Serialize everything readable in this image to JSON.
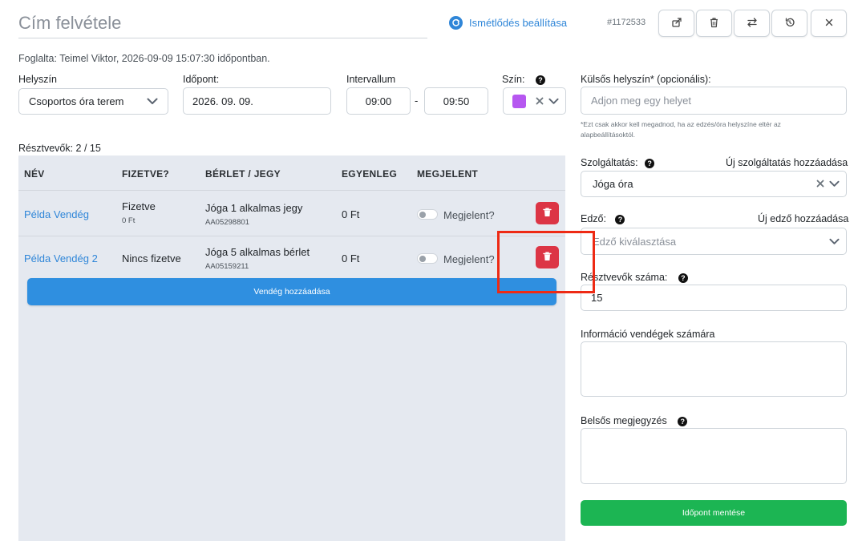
{
  "header": {
    "title_placeholder": "Cím felvétele",
    "recurrence_label": "Ismétlődés beállítása",
    "event_id": "#1172533"
  },
  "booked_by": "Foglalta: Teimel Viktor, 2026-09-09 15:07:30 időpontban.",
  "form": {
    "location_label": "Helyszín",
    "location_value": "Csoportos óra terem",
    "date_label": "Időpont:",
    "date_value": "2026. 09. 09.",
    "interval_label": "Intervallum",
    "interval_start": "09:00",
    "interval_sep": "-",
    "interval_end": "09:50",
    "color_label": "Szín:",
    "color_value": "#b657f0",
    "external_location_label": "Külsős helyszín* (opcionális):",
    "external_location_placeholder": "Adjon meg egy helyet",
    "external_hint": "*Ezt csak akkor kell megadnod, ha az edzés/óra helyszíne eltér az alapbeállításoktól.",
    "service_label": "Szolgáltatás:",
    "service_add_link": "Új szolgáltatás hozzáadása",
    "service_value": "Jóga óra",
    "trainer_label": "Edző:",
    "trainer_add_link": "Új edző hozzáadása",
    "trainer_placeholder": "Edző kiválasztása",
    "participants_count_label": "Résztvevők száma:",
    "participants_count_value": "15",
    "guest_info_label": "Információ vendégek számára",
    "internal_note_label": "Belsős megjegyzés",
    "save_label": "Időpont mentése"
  },
  "participants": {
    "count_label": "Résztvevők: 2 / 15",
    "columns": [
      "NÉV",
      "FIZETVE?",
      "BÉRLET / JEGY",
      "EGYENLEG",
      "MEGJELENT"
    ],
    "rows": [
      {
        "name": "Példa Vendég",
        "paid": "Fizetve",
        "paid_amount": "0 Ft",
        "pass": "Jóga 1 alkalmas jegy",
        "pass_code": "AA05298801",
        "balance": "0 Ft",
        "attended_label": "Megjelent?"
      },
      {
        "name": "Példa Vendég 2",
        "paid": "Nincs fizetve",
        "paid_amount": "",
        "pass": "Jóga 5 alkalmas bérlet",
        "pass_code": "AA05159211",
        "balance": "0 Ft",
        "attended_label": "Megjelent?"
      }
    ],
    "add_guest_label": "Vendég hozzáadása"
  },
  "icons": {
    "recurrence": "refresh-icon",
    "share": "share-icon",
    "delete": "trash-icon",
    "swap": "swap-icon",
    "history": "history-icon",
    "close": "close-icon",
    "help": "?"
  },
  "colors": {
    "primary": "#2f86d8",
    "danger": "#dc3545",
    "success": "#1cb553",
    "highlight": "#ee2a14",
    "table_bg": "#e5e9f0"
  }
}
